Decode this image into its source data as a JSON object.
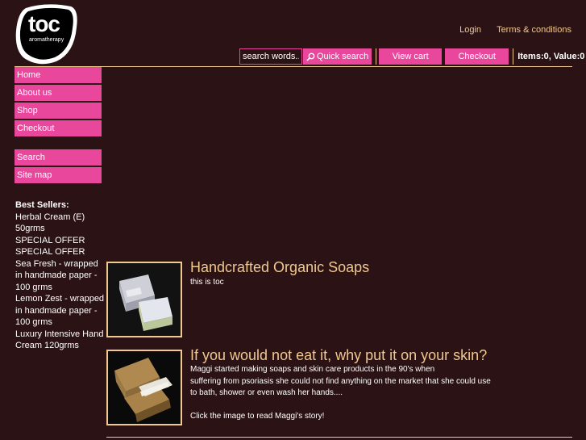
{
  "brand": {
    "logo_text": "toc",
    "logo_subtext": "aromatherapy"
  },
  "header": {
    "login_label": "Login",
    "terms_label": "Terms & conditions",
    "search_placeholder": "search words...",
    "quick_search_label": "Quick search",
    "view_cart_label": "View cart",
    "checkout_label": "Checkout",
    "cart_summary": "Items:0, Value:0"
  },
  "sidebar": {
    "nav_main": [
      {
        "label": "Home"
      },
      {
        "label": "About us"
      },
      {
        "label": "Shop"
      },
      {
        "label": "Checkout"
      }
    ],
    "nav_secondary": [
      {
        "label": "Search"
      },
      {
        "label": "Site map"
      }
    ],
    "best_sellers_title": "Best Sellers:",
    "best_sellers": [
      "Herbal Cream (E) 50grms",
      "SPECIAL OFFER",
      "SPECIAL OFFER",
      "Sea Fresh - wrapped in handmade paper - 100 grms",
      "Lemon Zest - wrapped in handmade paper - 100 grms",
      "Luxury Intensive Hand Cream 120grms"
    ]
  },
  "content": {
    "items": [
      {
        "title": "Handcrafted Organic Soaps",
        "text": [
          "this is toc"
        ]
      },
      {
        "title": "If you would not eat it, why put it on your skin?",
        "text": [
          "Maggi started making soaps and skin care products in the 90's when",
          "suffering from psoriasis she could not find anything on the market that she could use",
          "to bath, shower or even wash her hands....",
          "",
          "Click the image to read Maggi's story!"
        ]
      }
    ]
  },
  "colors": {
    "background": "#2b1214",
    "accent": "#e8479c",
    "gold": "#f0c890"
  }
}
